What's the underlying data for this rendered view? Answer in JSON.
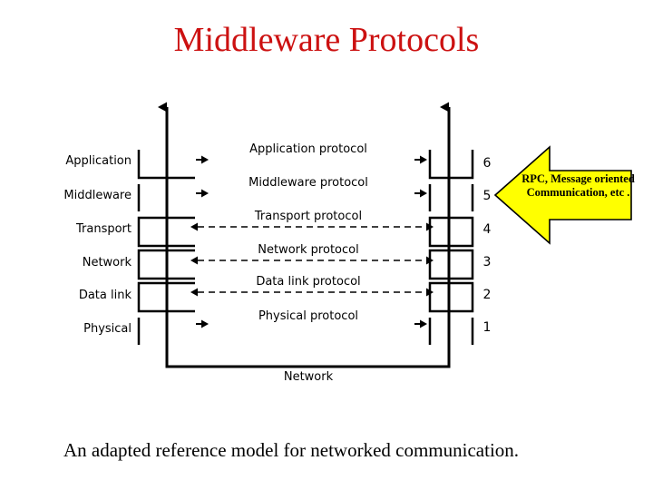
{
  "slide": {
    "title": "Middleware Protocols",
    "title_color": "#cc1111",
    "caption": "An adapted reference model for networked communication."
  },
  "diagram": {
    "layers": [
      {
        "name": "Application",
        "protocol": "Application protocol",
        "number": "6",
        "boxed": true,
        "dashed_link": false
      },
      {
        "name": "Middleware",
        "protocol": "Middleware protocol",
        "number": "5",
        "boxed": false,
        "dashed_link": false
      },
      {
        "name": "Transport",
        "protocol": "Transport protocol",
        "number": "4",
        "boxed": true,
        "dashed_link": true
      },
      {
        "name": "Network",
        "protocol": "Network protocol",
        "number": "3",
        "boxed": true,
        "dashed_link": true
      },
      {
        "name": "Data link",
        "protocol": "Data link protocol",
        "number": "2",
        "boxed": true,
        "dashed_link": true
      },
      {
        "name": "Physical",
        "protocol": "Physical protocol",
        "number": "1",
        "boxed": false,
        "dashed_link": false
      }
    ],
    "bus_label": "Network"
  },
  "callout": {
    "line1": "RPC, Message oriented",
    "line2": "Communication, etc .",
    "fill_color": "#ffff00",
    "stroke_color": "#000000"
  }
}
